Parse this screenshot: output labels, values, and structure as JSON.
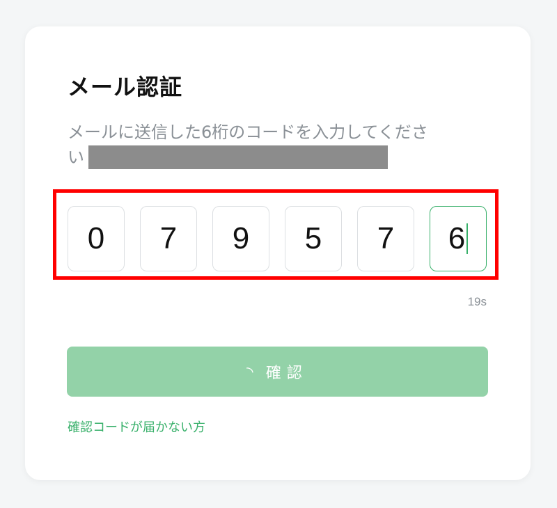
{
  "title": "メール認証",
  "description_line1": "メールに送信した6桁のコードを入力してくださ",
  "description_line2": "い",
  "otp": {
    "digits": [
      "0",
      "7",
      "9",
      "5",
      "7",
      "6"
    ],
    "active_index": 5
  },
  "timer": "19s",
  "confirm_button": {
    "spinner": "◝",
    "label": "確認"
  },
  "resend_link": "確認コードが届かない方",
  "colors": {
    "accent": "#38b06a",
    "button_disabled": "#93d2a8",
    "highlight": "#ff0000"
  }
}
